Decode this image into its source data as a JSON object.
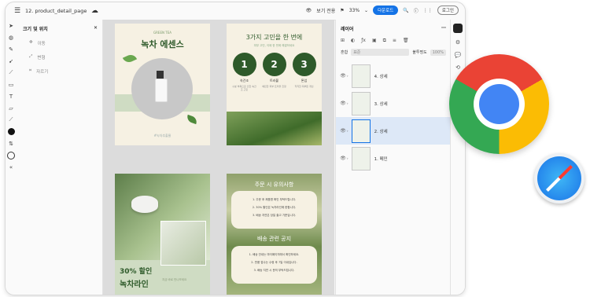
{
  "colors": {
    "accent": "#1473e6",
    "dark_green": "#2e5a2a",
    "mint": "#cfdcc3",
    "cream": "#f6f1e3"
  },
  "topbar": {
    "menu_icon": "hamburger-icon",
    "doc_title": "12. product_detail_page",
    "cloud_icon": "cloud-icon",
    "view_label": "보기 전용",
    "zoom": "33%",
    "share_label": "다운로드",
    "login_label": "로그인"
  },
  "tools_panel": {
    "title": "크기 및 위치",
    "items": [
      "이동",
      "변형",
      "자르기"
    ]
  },
  "canvas": {
    "p1": {
      "small": "GREEN TEA",
      "title": "녹차 에센스",
      "tag": "#녹차추출물"
    },
    "p2": {
      "title": "3가지 고민을 한 번에",
      "sub": "피부 고민, 이제 한 번에 해결하세요",
      "steps": [
        {
          "n": "1",
          "label": "속건조",
          "desc": "수분 부족으로 인한 속건조 고민"
        },
        {
          "n": "2",
          "label": "트러블",
          "desc": "예민한 피부 트러블 진정"
        },
        {
          "n": "3",
          "label": "톤업",
          "desc": "칙칙한 피부톤 개선"
        }
      ]
    },
    "p3": {
      "sale": "30% 할인",
      "name": "녹차라인",
      "desc": "지금 바로 만나보세요"
    },
    "p4": {
      "section1": "주문 시 유의사항",
      "list1": [
        "1. 주문 후 제품명 확인 부탁드립니다.",
        "2. 30% 할인은 녹차라인에 한합니다.",
        "3. 배송 지연은 당일 출고 기준입니다."
      ],
      "section2": "배송 관련 공지",
      "list2": [
        "1. 배송 안내는 마이페이지에서 확인하세요.",
        "2. 반품 접수는 수령 후 7일 이내입니다.",
        "3. 배송 지연 시 문의 부탁드립니다."
      ]
    }
  },
  "layers": {
    "title": "레이어",
    "blend_label": "혼합",
    "blend_value": "표준",
    "opacity_label": "불투명도",
    "opacity_value": "100%",
    "rows": [
      "4. 상세",
      "3. 상세",
      "2. 상세",
      "1. 메인"
    ]
  },
  "overlay": {
    "chrome_icon": "chrome-logo",
    "safari_icon": "safari-logo"
  }
}
